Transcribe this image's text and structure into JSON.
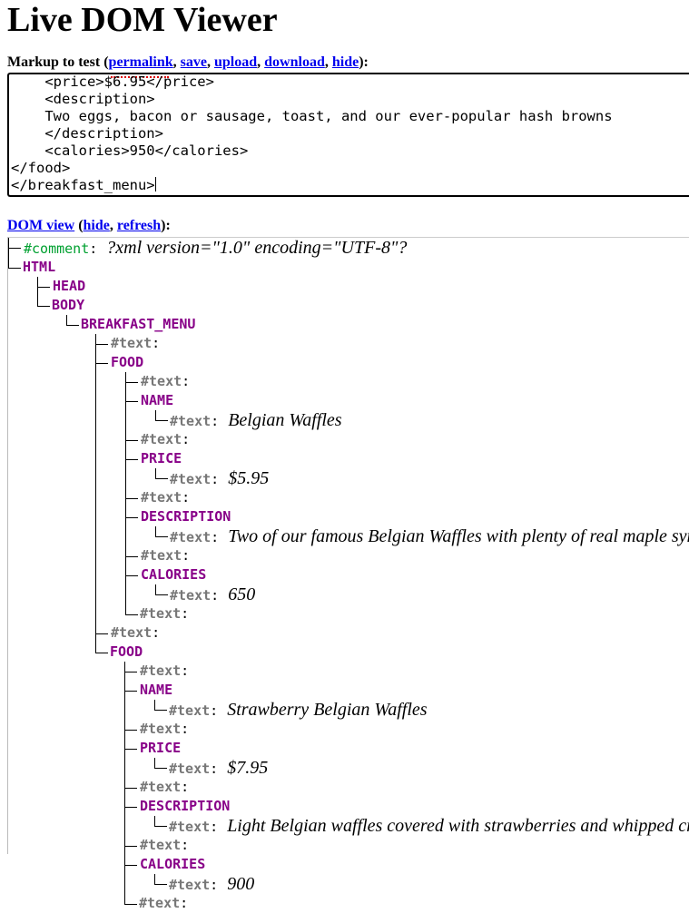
{
  "page_title": "Live DOM Viewer",
  "markup": {
    "heading": "Markup to test",
    "links": [
      "permalink",
      "save",
      "upload",
      "download",
      "hide"
    ],
    "code_lines": [
      "    <price>$6.95</price>",
      "    <description>",
      "    Two eggs, bacon or sausage, toast, and our ever-popular hash browns",
      "    </description>",
      "    <calories>950</calories>",
      "</food>",
      "</breakfast_menu>"
    ]
  },
  "dom_view": {
    "heading_link": "DOM view",
    "links": [
      "hide",
      "refresh"
    ],
    "tree": [
      {
        "type": "comment",
        "name": "#comment",
        "value": "?xml version=\"1.0\" encoding=\"UTF-8\"?"
      },
      {
        "type": "element",
        "name": "HTML",
        "children": [
          {
            "type": "element",
            "name": "HEAD",
            "children": []
          },
          {
            "type": "element",
            "name": "BODY",
            "children": [
              {
                "type": "element",
                "name": "BREAKFAST_MENU",
                "children": [
                  {
                    "type": "text",
                    "name": "#text",
                    "value": ""
                  },
                  {
                    "type": "element",
                    "name": "FOOD",
                    "children": [
                      {
                        "type": "text",
                        "name": "#text",
                        "value": ""
                      },
                      {
                        "type": "element",
                        "name": "NAME",
                        "children": [
                          {
                            "type": "text",
                            "name": "#text",
                            "value": "Belgian Waffles"
                          }
                        ]
                      },
                      {
                        "type": "text",
                        "name": "#text",
                        "value": ""
                      },
                      {
                        "type": "element",
                        "name": "PRICE",
                        "children": [
                          {
                            "type": "text",
                            "name": "#text",
                            "value": "$5.95"
                          }
                        ]
                      },
                      {
                        "type": "text",
                        "name": "#text",
                        "value": ""
                      },
                      {
                        "type": "element",
                        "name": "DESCRIPTION",
                        "children": [
                          {
                            "type": "text",
                            "name": "#text",
                            "value": "Two of our famous Belgian Waffles with plenty of real maple syrup"
                          }
                        ]
                      },
                      {
                        "type": "text",
                        "name": "#text",
                        "value": ""
                      },
                      {
                        "type": "element",
                        "name": "CALORIES",
                        "children": [
                          {
                            "type": "text",
                            "name": "#text",
                            "value": "650"
                          }
                        ]
                      },
                      {
                        "type": "text",
                        "name": "#text",
                        "value": ""
                      }
                    ]
                  },
                  {
                    "type": "text",
                    "name": "#text",
                    "value": ""
                  },
                  {
                    "type": "element",
                    "name": "FOOD",
                    "children": [
                      {
                        "type": "text",
                        "name": "#text",
                        "value": ""
                      },
                      {
                        "type": "element",
                        "name": "NAME",
                        "children": [
                          {
                            "type": "text",
                            "name": "#text",
                            "value": "Strawberry Belgian Waffles"
                          }
                        ]
                      },
                      {
                        "type": "text",
                        "name": "#text",
                        "value": ""
                      },
                      {
                        "type": "element",
                        "name": "PRICE",
                        "children": [
                          {
                            "type": "text",
                            "name": "#text",
                            "value": "$7.95"
                          }
                        ]
                      },
                      {
                        "type": "text",
                        "name": "#text",
                        "value": ""
                      },
                      {
                        "type": "element",
                        "name": "DESCRIPTION",
                        "children": [
                          {
                            "type": "text",
                            "name": "#text",
                            "value": "Light Belgian waffles covered with strawberries and whipped cream"
                          }
                        ]
                      },
                      {
                        "type": "text",
                        "name": "#text",
                        "value": ""
                      },
                      {
                        "type": "element",
                        "name": "CALORIES",
                        "children": [
                          {
                            "type": "text",
                            "name": "#text",
                            "value": "900"
                          }
                        ]
                      },
                      {
                        "type": "text",
                        "name": "#text",
                        "value": ""
                      }
                    ]
                  }
                ]
              }
            ]
          }
        ]
      }
    ]
  }
}
